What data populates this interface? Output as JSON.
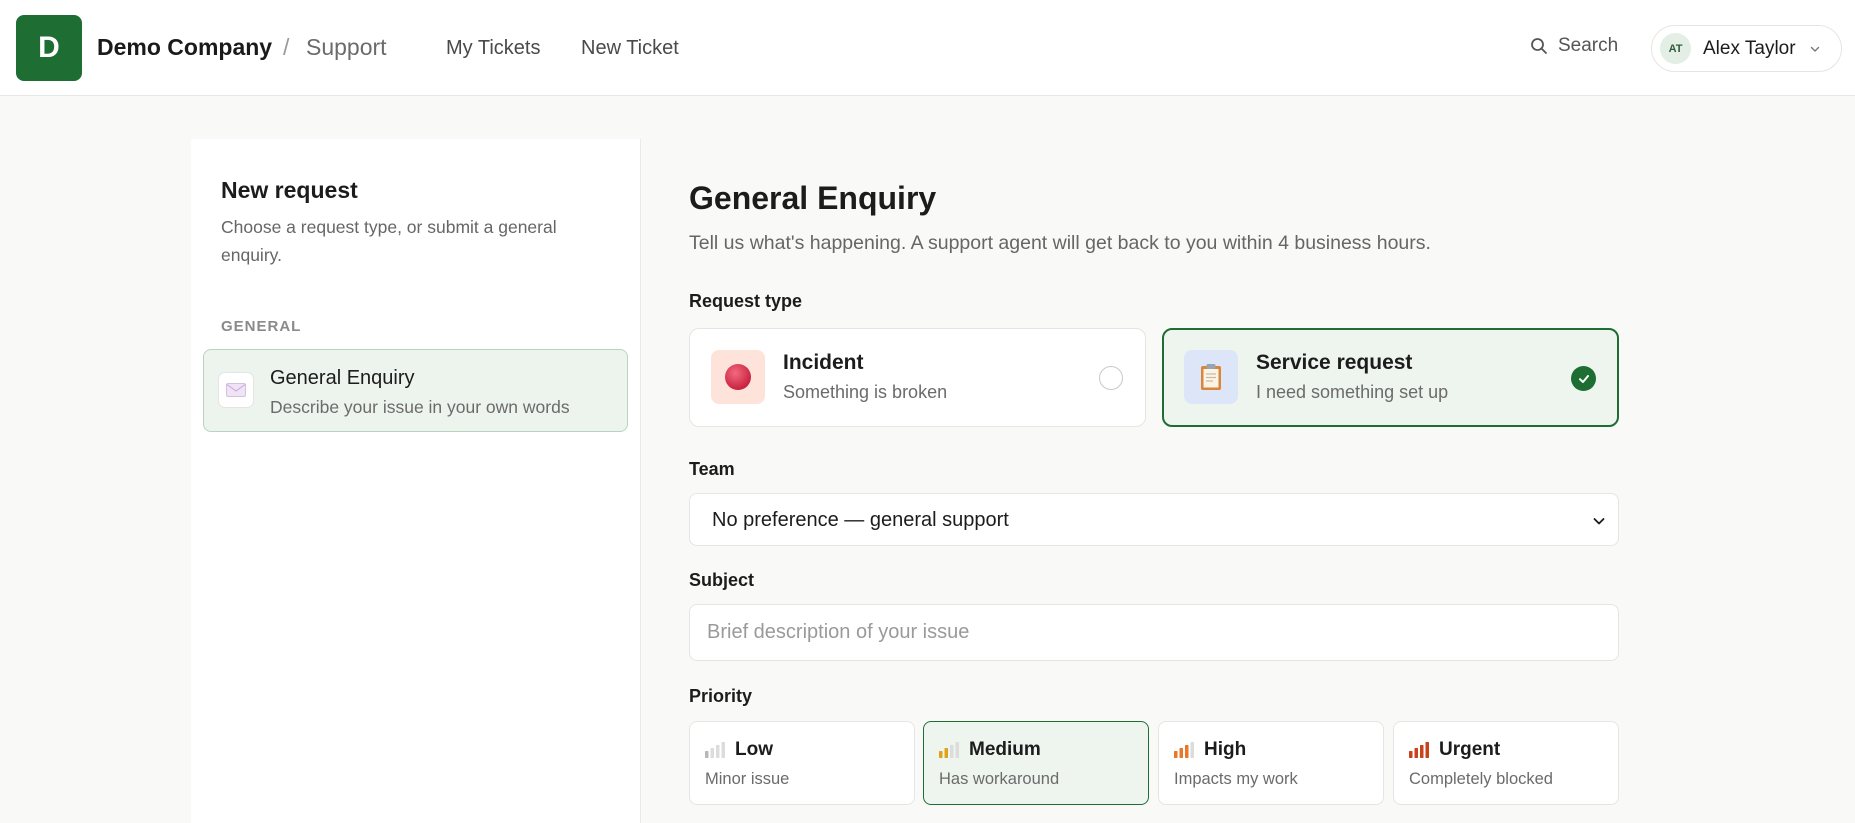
{
  "header": {
    "logo_letter": "D",
    "company": "Demo Company",
    "separator": "/",
    "section": "Support",
    "nav": [
      {
        "label": "My Tickets"
      },
      {
        "label": "New Ticket"
      }
    ],
    "search_label": "Search",
    "user": {
      "initials": "AT",
      "name": "Alex Taylor"
    }
  },
  "sidebar": {
    "title": "New request",
    "description": "Choose a request type, or submit a general enquiry.",
    "group_label": "GENERAL",
    "items": [
      {
        "title": "General Enquiry",
        "description": "Describe your issue in your own words",
        "selected": true
      }
    ]
  },
  "form": {
    "title": "General Enquiry",
    "subtitle": "Tell us what's happening. A support agent will get back to you within 4 business hours.",
    "request_type_label": "Request type",
    "request_types": [
      {
        "title": "Incident",
        "description": "Something is broken",
        "selected": false
      },
      {
        "title": "Service request",
        "description": "I need something set up",
        "selected": true
      }
    ],
    "team_label": "Team",
    "team_value": "No preference — general support",
    "subject_label": "Subject",
    "subject_placeholder": "Brief description of your issue",
    "subject_value": "",
    "priority_label": "Priority",
    "priorities": [
      {
        "title": "Low",
        "description": "Minor issue",
        "level": 1,
        "selected": false
      },
      {
        "title": "Medium",
        "description": "Has workaround",
        "level": 2,
        "selected": true
      },
      {
        "title": "High",
        "description": "Impacts my work",
        "level": 3,
        "selected": false
      },
      {
        "title": "Urgent",
        "description": "Completely blocked",
        "level": 4,
        "selected": false
      }
    ]
  },
  "colors": {
    "brand": "#1e6e34",
    "selected_bg": "#eef5ef",
    "priority_low": "#b8b8b8",
    "priority_medium": "#e0a21a",
    "priority_high": "#e8792a",
    "priority_urgent": "#c8421c"
  },
  "icons": {
    "search": "search-icon",
    "user_menu": "chevron-down-icon",
    "general_enquiry": "envelope-icon",
    "incident": "red-circle-icon",
    "service_request": "clipboard-icon",
    "team_select": "chevron-down-icon",
    "selected": "check-icon",
    "priority": "signal-bars-icon"
  }
}
